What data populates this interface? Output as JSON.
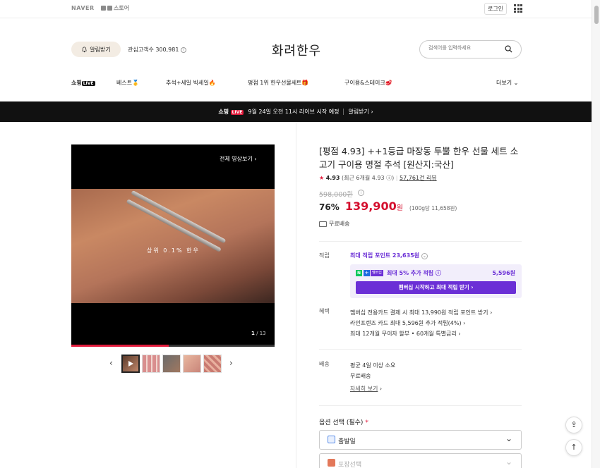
{
  "topbar": {
    "naver": "NAVER",
    "store": "스토어",
    "login": "로그인",
    "apps_icon": "grid-icon"
  },
  "header": {
    "alarm_label": "알림받기",
    "interest_label": "관심고객수 300,981",
    "brand": "화려한우",
    "search_placeholder": "검색어를 입력하세요"
  },
  "nav": {
    "items": [
      {
        "label": "쇼핑",
        "tag": "LIVE"
      },
      {
        "label": "베스트🥇"
      },
      {
        "label": "추석+세일 빅세일🔥"
      },
      {
        "label": "평점 1위 한우선물세트🎁"
      },
      {
        "label": "구이용&스테이크🥩"
      }
    ],
    "more": "더보기"
  },
  "banner": {
    "shop": "쇼핑",
    "tag": "LIVE",
    "text": "9월 24일 오전 11시 라이브 시작 예정",
    "alarm": "알림받기"
  },
  "video": {
    "fullview": "전체 영상보기",
    "caption": "상위 0.1% 한우",
    "current": "1",
    "total": "/ 13",
    "progress": 0.48
  },
  "product": {
    "title": "[평점 4.93] ++1등급 마장동 투뿔 한우 선물 세트 소고기 구이용 명절 추석 [원산지:국산]",
    "rating_score": "4.93",
    "rating_recent": "(최근 6개월 4.93",
    "rating_recent_end": ")",
    "reviews": "57,761건 리뷰",
    "original_price": "598,000원",
    "discount": "76%",
    "price": "139,900",
    "won": "원",
    "unit_price": "(100g당 11,658원)",
    "shipping": "무료배송"
  },
  "points": {
    "label": "적립",
    "title": "최대 적립 포인트 23,635원",
    "extra": "최대 5% 추가 적립",
    "amount": "5,596원",
    "membership_tag": "멤버십",
    "cta": "멤버십 시작하고 최대 적립 받기"
  },
  "benefits": {
    "label": "혜택",
    "lines": [
      "멤버십 전용카드 결제 시 최대 13,990원 적립 포인트 받기",
      "라인프렌즈 카드 최대 5,596원 추가 적립(4%)",
      "최대 12개월 무이자 할부 • 60개월 특별금리"
    ]
  },
  "delivery": {
    "label": "배송",
    "lines": [
      "평균 4일 이상 소요",
      "무료배송"
    ],
    "more": "자세히 보기"
  },
  "options": {
    "title": "옵션 선택 (필수)",
    "required": "*",
    "select1": "출발일",
    "select2": "포장선택"
  },
  "colors": {
    "accent_red": "#d40f2e",
    "membership_purple": "#6b2fd6"
  }
}
